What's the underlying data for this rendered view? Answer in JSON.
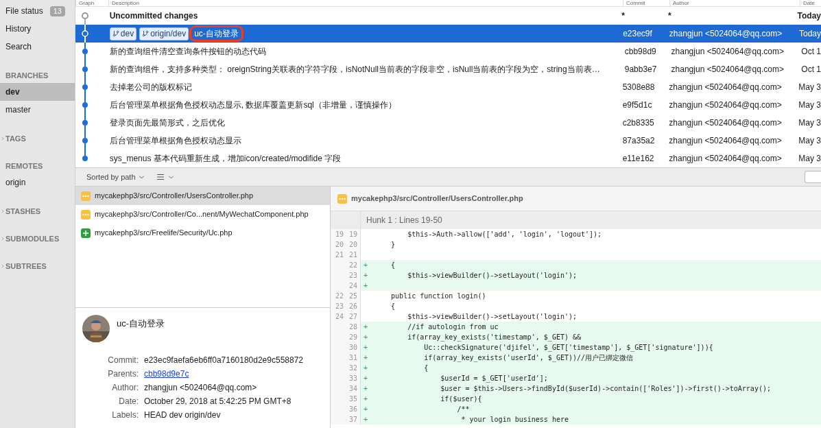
{
  "sidebar": {
    "nav": [
      {
        "label": "File status",
        "badge": "13",
        "selected": false
      },
      {
        "label": "History",
        "selected": false
      },
      {
        "label": "Search",
        "selected": false
      }
    ],
    "sections": [
      {
        "title": "BRANCHES",
        "expanded": true,
        "items": [
          {
            "label": "dev",
            "selected": true
          },
          {
            "label": "master",
            "selected": false
          }
        ]
      },
      {
        "title": "TAGS",
        "expanded": false
      },
      {
        "title": "REMOTES",
        "expanded": true,
        "items": [
          {
            "label": "origin",
            "selected": false
          }
        ]
      },
      {
        "title": "STASHES",
        "expanded": false
      },
      {
        "title": "SUBMODULES",
        "expanded": false
      },
      {
        "title": "SUBTREES",
        "expanded": false
      }
    ]
  },
  "table": {
    "columns": [
      "Graph",
      "Description",
      "Commit",
      "Author",
      "Date"
    ],
    "rows": [
      {
        "kind": "uncommitted",
        "selected": false,
        "description": "Uncommitted changes",
        "commit": "*",
        "author": "*",
        "date": "Today"
      },
      {
        "kind": "commit",
        "selected": true,
        "labels": [
          "dev",
          "origin/dev"
        ],
        "description": "uc-自动登录",
        "highlighted": true,
        "commit": "e23ec9f",
        "author": "zhangjun <5024064@qq.com>",
        "date": "Today"
      },
      {
        "kind": "commit",
        "selected": false,
        "description": "新的查询组件清空查询条件按钮的动态代码",
        "commit": "cbb98d9",
        "author": "zhangjun <5024064@qq.com>",
        "date": "Oct 1"
      },
      {
        "kind": "commit",
        "selected": false,
        "description": "新的查询组件，支持多种类型： oreignString关联表的字符字段，isNotNull当前表的字段非空，isNull当前表的字段为空，string当前表…",
        "commit": "9abb3e7",
        "author": "zhangjun <5024064@qq.com>",
        "date": "Oct 1"
      },
      {
        "kind": "commit",
        "selected": false,
        "description": "去掉老公司的版权标记",
        "commit": "5308e88",
        "author": "zhangjun <5024064@qq.com>",
        "date": "May 3"
      },
      {
        "kind": "commit",
        "selected": false,
        "description": "后台管理菜单根据角色授权动态显示, 数据库覆盖更新sql（非增量，谨慎操作）",
        "commit": "e9f5d1c",
        "author": "zhangjun <5024064@qq.com>",
        "date": "May 3"
      },
      {
        "kind": "commit",
        "selected": false,
        "description": "登录页面先最简形式，之后优化",
        "commit": "c2b8335",
        "author": "zhangjun <5024064@qq.com>",
        "date": "May 3"
      },
      {
        "kind": "commit",
        "selected": false,
        "description": "后台管理菜单根据角色授权动态显示",
        "commit": "87a35a2",
        "author": "zhangjun <5024064@qq.com>",
        "date": "May 3"
      },
      {
        "kind": "commit",
        "selected": false,
        "description": "sys_menus 基本代码重新生成，增加icon/created/modifide 字段",
        "commit": "e11e162",
        "author": "zhangjun <5024064@qq.com>",
        "date": "May 3"
      }
    ]
  },
  "toolbar": {
    "sort": "Sorted by path"
  },
  "files": [
    {
      "kind": "modified",
      "path": "mycakephp3/src/Controller/UsersController.php",
      "selected": true
    },
    {
      "kind": "modified",
      "path": "mycakephp3/src/Controller/Co...nent/MyWechatComponent.php",
      "selected": false
    },
    {
      "kind": "added",
      "path": "mycakephp3/src/Freelife/Security/Uc.php",
      "selected": false
    }
  ],
  "details": {
    "message": "uc-自动登录",
    "fields": [
      {
        "label": "Commit:",
        "value": "e23ec9faefa6eb6ff0a7160180d2e9c558872"
      },
      {
        "label": "Parents:",
        "value": "cbb98d9e7c",
        "kind": "link"
      },
      {
        "label": "Author:",
        "value": "zhangjun <5024064@qq.com>"
      },
      {
        "label": "Date:",
        "value": "October 29, 2018 at 5:42:25 PM GMT+8"
      },
      {
        "label": "Labels:",
        "value": "HEAD dev origin/dev"
      }
    ]
  },
  "diff": {
    "file": "mycakephp3/src/Controller/UsersController.php",
    "hunk": "Hunk 1 : Lines 19-50",
    "lines": [
      {
        "kind": "context",
        "old": "19",
        "new": "19",
        "text": "        $this->Auth->allow(['add', 'login', 'logout']);"
      },
      {
        "kind": "context",
        "old": "20",
        "new": "20",
        "text": "    }"
      },
      {
        "kind": "context",
        "old": "21",
        "new": "21"
      },
      {
        "kind": "added",
        "new": "22",
        "sign": "+",
        "text": "    {"
      },
      {
        "kind": "added",
        "new": "23",
        "sign": "+",
        "text": "        $this->viewBuilder()->setLayout('login');"
      },
      {
        "kind": "added",
        "new": "24",
        "sign": "+"
      },
      {
        "kind": "context",
        "old": "22",
        "new": "25",
        "text": "    public function login()"
      },
      {
        "kind": "context",
        "old": "23",
        "new": "26",
        "text": "    {"
      },
      {
        "kind": "context",
        "old": "24",
        "new": "27",
        "text": "        $this->viewBuilder()->setLayout('login');"
      },
      {
        "kind": "added",
        "new": "28",
        "sign": "+",
        "text": "        //if autologin from uc"
      },
      {
        "kind": "added",
        "new": "29",
        "sign": "+",
        "text": "        if(array_key_exists('timestamp', $_GET) &&"
      },
      {
        "kind": "added",
        "new": "30",
        "sign": "+",
        "text": "            Uc::checkSignature('djifel', $_GET['timestamp'], $_GET['signature'])){"
      },
      {
        "kind": "added",
        "new": "31",
        "sign": "+",
        "text": "            if(array_key_exists('userId', $_GET))//用户已绑定微信"
      },
      {
        "kind": "added",
        "new": "32",
        "sign": "+",
        "text": "            {"
      },
      {
        "kind": "added",
        "new": "33",
        "sign": "+",
        "text": "                $userId = $_GET['userId'];"
      },
      {
        "kind": "added",
        "new": "34",
        "sign": "+",
        "text": "                $user = $this->Users->findById($userId)->contain(['Roles'])->first()->toArray();"
      },
      {
        "kind": "added",
        "new": "35",
        "sign": "+",
        "text": "                if($user){"
      },
      {
        "kind": "added",
        "new": "36",
        "sign": "+",
        "text": "                    /**"
      },
      {
        "kind": "added",
        "new": "37",
        "sign": "+",
        "text": "                     * your login business here"
      }
    ]
  }
}
